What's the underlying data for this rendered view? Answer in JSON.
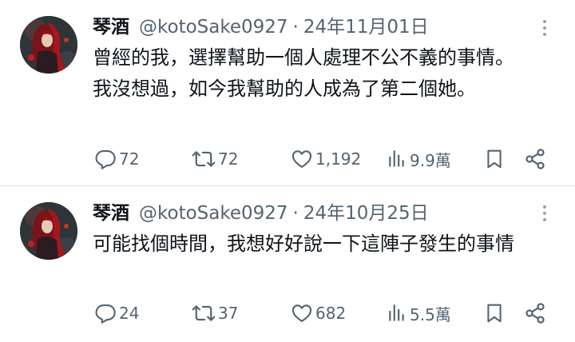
{
  "tweets": [
    {
      "display_name": "琴酒",
      "handle": "@kotoSake0927",
      "separator": "·",
      "date": "24年11月01日",
      "paragraphs": [
        "曾經的我，選擇幫助一個人處理不公不義的事情。",
        "我沒想過，如今我幫助的人成為了第二個她。"
      ],
      "stats": {
        "replies": "72",
        "reposts": "72",
        "likes": "1,192",
        "views": "9.9萬"
      }
    },
    {
      "display_name": "琴酒",
      "handle": "@kotoSake0927",
      "separator": "·",
      "date": "24年10月25日",
      "paragraphs": [
        "可能找個時間，我想好好說一下這陣子發生的事情"
      ],
      "stats": {
        "replies": "24",
        "reposts": "37",
        "likes": "682",
        "views": "5.5萬"
      }
    }
  ],
  "icons": {
    "reply": "reply-icon",
    "repost": "repost-icon",
    "like": "heart-icon",
    "views": "views-icon",
    "bookmark": "bookmark-icon",
    "share": "share-icon",
    "more": "more-icon"
  },
  "colors": {
    "text": "#0f1419",
    "secondary": "#536471",
    "divider": "#e1e6ea"
  }
}
